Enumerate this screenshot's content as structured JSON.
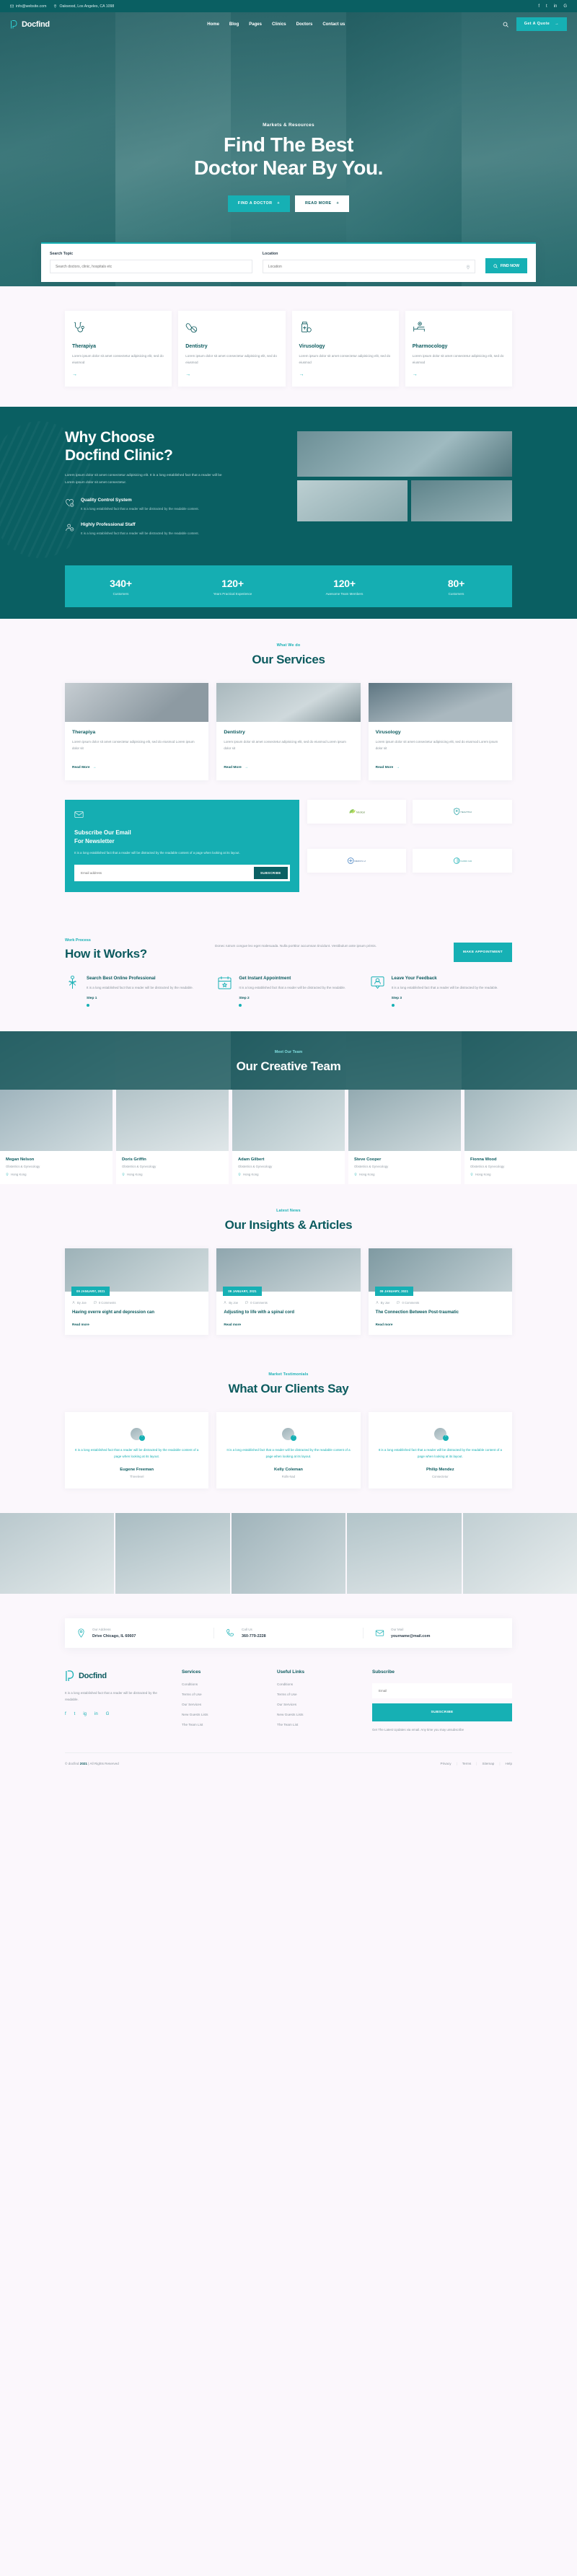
{
  "brand": {
    "name": "Docfind"
  },
  "topbar": {
    "email": "info@website.com",
    "address": "Oakwood, Los Angeles, CA 1098",
    "social": [
      "f",
      "t",
      "in",
      "G"
    ]
  },
  "nav": {
    "items": [
      "Home",
      "Blog",
      "Pages",
      "Clinics",
      "Doctors",
      "Contact us"
    ],
    "cta": "Get A Quote"
  },
  "hero": {
    "kicker": "Markets & Resources",
    "title_line1": "Find The Best",
    "title_line2": "Doctor Near By You.",
    "btn_primary": "FIND A DOCTOR",
    "btn_secondary": "READ MORE"
  },
  "search": {
    "topic_label": "Search Topic",
    "topic_placeholder": "Search doctors, clinic, hospitals etc",
    "location_label": "Location",
    "location_placeholder": "Location",
    "button": "FIND NOW"
  },
  "features": [
    {
      "icon": "stethoscope-icon",
      "title": "Therapiya",
      "text": "Lorem ipsum dolor sit amet consectetur adipisicing elit, sed do eiusmod"
    },
    {
      "icon": "pills-icon",
      "title": "Dentistry",
      "text": "Lorem ipsum dolor sit amet consectetur adipisicing elit, sed do eiusmod"
    },
    {
      "icon": "medicine-bottle-icon",
      "title": "Virusology",
      "text": "Lorem ipsum dolor sit amet consectetur adipisicing elit, sed do eiusmod"
    },
    {
      "icon": "hospital-bed-icon",
      "title": "Pharmocology",
      "text": "Lorem ipsum dolor sit amet consectetur adipisicing elit, sed do eiusmod"
    }
  ],
  "why": {
    "title_line1": "Why Choose",
    "title_line2": "Docfind Clinic?",
    "paragraph": "Lorem ipsum dolor sit amet consectetur adipisicing elit. It is a long established fact that a reader will be Lorem ipsum dolor sit amet consectetur.",
    "items": [
      {
        "icon": "heart-check-icon",
        "title": "Quality Control System",
        "text": "It is a long established fact that a reader will be distracted by the readable content."
      },
      {
        "icon": "user-badge-icon",
        "title": "Highly Professional Staff",
        "text": "It is a long established fact that a reader will be distracted by the readable content."
      }
    ],
    "stats": [
      {
        "number": "340+",
        "label": "Customers"
      },
      {
        "number": "120+",
        "label": "Years Practical Experience"
      },
      {
        "number": "120+",
        "label": "Awesome Team Members"
      },
      {
        "number": "80+",
        "label": "Customers"
      }
    ]
  },
  "services": {
    "kicker": "What We do",
    "title": "Our Services",
    "read_more": "Read More",
    "cards": [
      {
        "title": "Therapiya",
        "text": "Lorem ipsum dolor sit amet consectetur adipisicing elit, sed do eiusmod Lorem ipsum dolor sit"
      },
      {
        "title": "Dentistry",
        "text": "Lorem ipsum dolor sit amet consectetur adipisicing elit, sed do eiusmod Lorem ipsum dolor sit"
      },
      {
        "title": "Virusology",
        "text": "Lorem ipsum dolor sit amet consectetur adipisicing elit, sed do eiusmod Lorem ipsum dolor sit"
      }
    ]
  },
  "newsletter": {
    "icon": "envelope-icon",
    "title_line1": "Subscribe Our Email",
    "title_line2": "For Newsletter",
    "text": "It is a long established fact that a reader will be distracted by the readable content of a page when looking at its layout.",
    "placeholder": "Email address",
    "button": "SUBSCRIBE",
    "brands": [
      "leaf-brand-logo",
      "shield-brand-logo",
      "cross-brand-logo",
      "circle-brand-logo"
    ]
  },
  "how_it_works": {
    "kicker": "Work Process",
    "title": "How it Works?",
    "paragraph": "Donec rutrum congue leo eget malesuada. Nulla porttitor accumsan tincidunt. Vestibulum ante ipsum primis.",
    "button": "MAKE APPOINTMENT",
    "steps": [
      {
        "icon": "caduceus-icon",
        "title": "Search Best Online Professional",
        "text": "It is a long established fact that a reader will be distracted by the readable.",
        "step": "Step 1"
      },
      {
        "icon": "calendar-icon",
        "title": "Get Instant Appointment",
        "text": "It is a long established fact that a reader will be distracted by the readable.",
        "step": "Step 2"
      },
      {
        "icon": "feedback-icon",
        "title": "Leave Your Feedback",
        "text": "It is a long established fact that a reader will be distracted by the readable.",
        "step": "Step 3"
      }
    ]
  },
  "team": {
    "kicker": "Meet Our Team",
    "title": "Our Creative Team",
    "members": [
      {
        "name": "Megan Nelson",
        "role": "Obstetrics & Gynecology",
        "location": "Hong Kong"
      },
      {
        "name": "Doris Griffin",
        "role": "Obstetrics & Gynecology",
        "location": "Hong Kong"
      },
      {
        "name": "Adam Gilbert",
        "role": "Obstetrics & Gynecology",
        "location": "Hong Kong"
      },
      {
        "name": "Steve Cooper",
        "role": "Obstetrics & Gynecology",
        "location": "Hong Kong"
      },
      {
        "name": "Fionna Wood",
        "role": "Obstetrics & Gynecology",
        "location": "Hong Kong"
      }
    ]
  },
  "blog": {
    "kicker": "Latest News",
    "title": "Our Insights & Articles",
    "read_more": "Read more",
    "posts": [
      {
        "date": "09 JANUARY, 2021",
        "author": "By Joe",
        "comments": "0 Comments",
        "title": "Having overre eight and depression can"
      },
      {
        "date": "09 JANUARY, 2021",
        "author": "By Joe",
        "comments": "0 Comments",
        "title": "Adjusting to life with a spinal cord"
      },
      {
        "date": "09 JANUARY, 2021",
        "author": "By Joe",
        "comments": "0 Comments",
        "title": "The Connection Between Post-traumatic"
      }
    ]
  },
  "testimonials": {
    "kicker": "Market Testimonials",
    "title": "What Our Clients Say",
    "items": [
      {
        "text": "It is a long established fact that a reader will be distracted by the readable content of a page when looking at its layout.",
        "name": "Eugene Freeman",
        "role": "Threelevel"
      },
      {
        "text": "It is a long established fact that a reader will be distracted by the readable content of a page when looking at its layout.",
        "name": "Kelly Coleman",
        "role": "Rolls-Nad"
      },
      {
        "text": "It is a long established fact that a reader will be distracted by the readable content of a page when looking at its layout.",
        "name": "Philip Mendez",
        "role": "Consectetur"
      }
    ]
  },
  "contact": [
    {
      "icon": "location-pin-icon",
      "label": "Our Address",
      "value": "Drive Chicago, IL 60607"
    },
    {
      "icon": "phone-icon",
      "label": "Call Us",
      "value": "360-779-2228"
    },
    {
      "icon": "mail-icon",
      "label": "Our Mail",
      "value": "yourname@mail.com"
    }
  ],
  "footer": {
    "description": "It is a long established fact that a reader will be distracted by the readable.",
    "social": [
      "f",
      "t",
      "ig",
      "in",
      "G"
    ],
    "services_title": "Services",
    "services": [
      "Conditions",
      "Terms of Use",
      "Our Services",
      "New Guests Lists",
      "The Team List"
    ],
    "useful_title": "Useful Links",
    "useful": [
      "Conditions",
      "Terms of Use",
      "Our Services",
      "New Guests Lists",
      "The Team List"
    ],
    "subscribe_title": "Subscribe",
    "subscribe_placeholder": "Email",
    "subscribe_button": "SUBSCRIBE",
    "subscribe_note": "Get The Latest Updates via email. Any time you may unsubscribe",
    "copyright_pre": "© docfind",
    "copyright_year": "2021",
    "copyright_post": "| All Rights Reserved",
    "bottom_links": [
      "Privacy",
      "Terms",
      "Sitemap",
      "Help"
    ]
  }
}
